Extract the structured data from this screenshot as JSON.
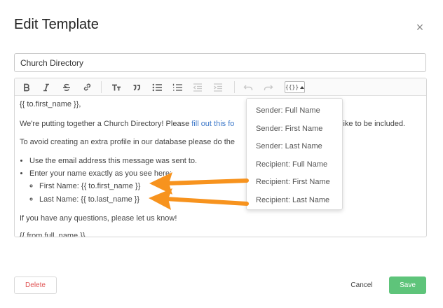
{
  "modal": {
    "title": "Edit Template",
    "close_icon": "×"
  },
  "template_name": {
    "value": "Church Directory"
  },
  "toolbar": {
    "icons": [
      "bold-icon",
      "italic-icon",
      "strikethrough-icon",
      "link-icon",
      "heading-icon",
      "quote-icon",
      "bullet-list-icon",
      "numbered-list-icon",
      "outdent-icon",
      "indent-icon",
      "undo-icon",
      "redo-icon",
      "variables-icon"
    ],
    "variables_label": "{{}}"
  },
  "editor": {
    "line1": "{{ to.first_name }},",
    "line2_start": "We're putting together a Church Directory! Please ",
    "line2_link": "fill out this fo",
    "line2_end": "like to be included.",
    "line3": "To avoid creating an extra profile in our database please do the",
    "bullet1": "Use the email address this message was sent to.",
    "bullet2": "Enter your name exactly as you see here:",
    "sub1": "First Name: {{ to.first_name }}",
    "sub2": "Last Name: {{ to.last_name }}",
    "line4": "If you have any questions, please let us know!",
    "line5": "{{ from.full_name }}"
  },
  "dropdown": {
    "items": [
      "Sender: Full Name",
      "Sender: First Name",
      "Sender: Last Name",
      "Recipient: Full Name",
      "Recipient: First Name",
      "Recipient: Last Name"
    ]
  },
  "annotations": {
    "arrow_color": "#f7931e"
  },
  "footer": {
    "delete_label": "Delete",
    "cancel_label": "Cancel",
    "save_label": "Save"
  },
  "colors": {
    "save": "#5ec47a",
    "delete_text": "#e05555",
    "link": "#3d78c9"
  }
}
